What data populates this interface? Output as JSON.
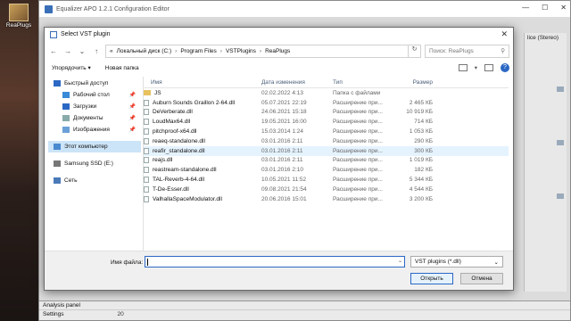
{
  "desktop": {
    "icon_label": "ReaPlugs"
  },
  "eq_window": {
    "title": "Equalizer APO 1.2.1 Configuration Editor",
    "right_panel_label": "lice (Stereo)",
    "analysis_panel_label": "Analysis panel",
    "settings_label": "Settings",
    "settings_value": "20"
  },
  "dialog": {
    "title": "Select VST plugin",
    "breadcrumbs": [
      "«",
      "Локальный диск (C:)",
      "Program Files",
      "VSTPlugins",
      "ReaPlugs"
    ],
    "search_placeholder": "Поиск: ReaPlugs",
    "toolbar": {
      "organize": "Упорядочить ▾",
      "new_folder": "Новая папка"
    },
    "nav": [
      {
        "label": "Быстрый доступ",
        "icon": "star-icon",
        "color": "#2b68c4",
        "sub": false,
        "pin": false
      },
      {
        "label": "Рабочий стол",
        "icon": "desktop-icon",
        "color": "#3a8ad8",
        "sub": true,
        "pin": true
      },
      {
        "label": "Загрузки",
        "icon": "downloads-icon",
        "color": "#2b68c4",
        "sub": true,
        "pin": true
      },
      {
        "label": "Документы",
        "icon": "documents-icon",
        "color": "#8aa",
        "sub": true,
        "pin": true
      },
      {
        "label": "Изображения",
        "icon": "pictures-icon",
        "color": "#6aa0d8",
        "sub": true,
        "pin": true
      },
      {
        "label": "Этот компьютер",
        "icon": "computer-icon",
        "color": "#4a8ad0",
        "sub": false,
        "pin": false,
        "selected": true
      },
      {
        "label": "Samsung SSD (E:)",
        "icon": "drive-icon",
        "color": "#777",
        "sub": false,
        "pin": false
      },
      {
        "label": "Сеть",
        "icon": "network-icon",
        "color": "#4a7ab8",
        "sub": false,
        "pin": false
      }
    ],
    "columns": {
      "name": "Имя",
      "date": "Дата изменения",
      "type": "Тип",
      "size": "Размер"
    },
    "files": [
      {
        "name": "JS",
        "date": "02.02.2022 4:13",
        "type": "Папка с файлами",
        "size": "",
        "folder": true
      },
      {
        "name": "Auburn Sounds Graillon 2-64.dll",
        "date": "05.07.2021 22:19",
        "type": "Расширение при...",
        "size": "2 465 КБ"
      },
      {
        "name": "DeVerberate.dll",
        "date": "24.06.2021 15:18",
        "type": "Расширение при...",
        "size": "10 919 КБ"
      },
      {
        "name": "LoudMax64.dll",
        "date": "19.05.2021 16:00",
        "type": "Расширение при...",
        "size": "714 КБ"
      },
      {
        "name": "pitchproof-x64.dll",
        "date": "15.03.2014 1:24",
        "type": "Расширение при...",
        "size": "1 053 КБ"
      },
      {
        "name": "reaeq-standalone.dll",
        "date": "03.01.2016 2:11",
        "type": "Расширение при...",
        "size": "290 КБ"
      },
      {
        "name": "reafir_standalone.dll",
        "date": "03.01.2016 2:11",
        "type": "Расширение при...",
        "size": "300 КБ",
        "hover": true
      },
      {
        "name": "reajs.dll",
        "date": "03.01.2016 2:11",
        "type": "Расширение при...",
        "size": "1 019 КБ"
      },
      {
        "name": "reastream-standalone.dll",
        "date": "03.01.2016 2:10",
        "type": "Расширение при...",
        "size": "182 КБ"
      },
      {
        "name": "TAL-Reverb-4-64.dll",
        "date": "10.05.2021 11:52",
        "type": "Расширение при...",
        "size": "5 344 КБ"
      },
      {
        "name": "T-De-Esser.dll",
        "date": "09.08.2021 21:54",
        "type": "Расширение при...",
        "size": "4 544 КБ"
      },
      {
        "name": "ValhallaSpaceModulator.dll",
        "date": "20.06.2016 15:01",
        "type": "Расширение при...",
        "size": "3 200 КБ"
      }
    ],
    "filename_label": "Имя файла:",
    "filename_value": "",
    "filter_value": "VST plugins (*.dll)",
    "open_label": "Открыть",
    "cancel_label": "Отмена"
  }
}
